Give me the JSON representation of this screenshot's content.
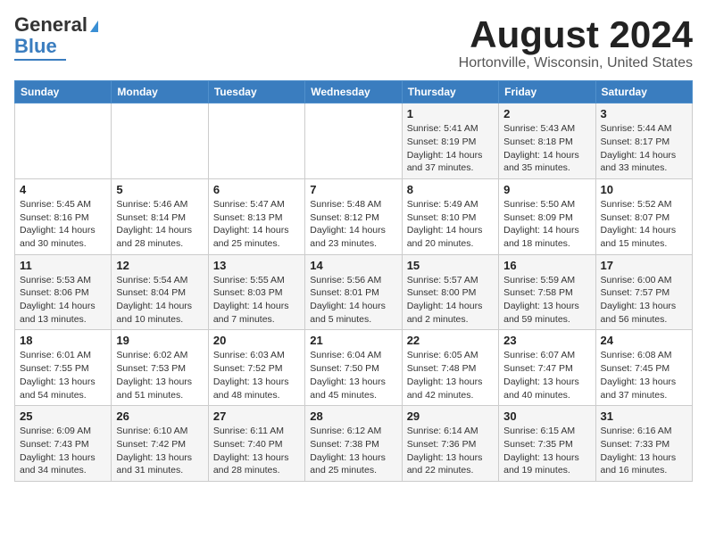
{
  "header": {
    "logo_line1": "General",
    "logo_line2": "Blue",
    "title": "August 2024",
    "location": "Hortonville, Wisconsin, United States"
  },
  "days_of_week": [
    "Sunday",
    "Monday",
    "Tuesday",
    "Wednesday",
    "Thursday",
    "Friday",
    "Saturday"
  ],
  "weeks": [
    [
      {
        "day": "",
        "info": ""
      },
      {
        "day": "",
        "info": ""
      },
      {
        "day": "",
        "info": ""
      },
      {
        "day": "",
        "info": ""
      },
      {
        "day": "1",
        "info": "Sunrise: 5:41 AM\nSunset: 8:19 PM\nDaylight: 14 hours\nand 37 minutes."
      },
      {
        "day": "2",
        "info": "Sunrise: 5:43 AM\nSunset: 8:18 PM\nDaylight: 14 hours\nand 35 minutes."
      },
      {
        "day": "3",
        "info": "Sunrise: 5:44 AM\nSunset: 8:17 PM\nDaylight: 14 hours\nand 33 minutes."
      }
    ],
    [
      {
        "day": "4",
        "info": "Sunrise: 5:45 AM\nSunset: 8:16 PM\nDaylight: 14 hours\nand 30 minutes."
      },
      {
        "day": "5",
        "info": "Sunrise: 5:46 AM\nSunset: 8:14 PM\nDaylight: 14 hours\nand 28 minutes."
      },
      {
        "day": "6",
        "info": "Sunrise: 5:47 AM\nSunset: 8:13 PM\nDaylight: 14 hours\nand 25 minutes."
      },
      {
        "day": "7",
        "info": "Sunrise: 5:48 AM\nSunset: 8:12 PM\nDaylight: 14 hours\nand 23 minutes."
      },
      {
        "day": "8",
        "info": "Sunrise: 5:49 AM\nSunset: 8:10 PM\nDaylight: 14 hours\nand 20 minutes."
      },
      {
        "day": "9",
        "info": "Sunrise: 5:50 AM\nSunset: 8:09 PM\nDaylight: 14 hours\nand 18 minutes."
      },
      {
        "day": "10",
        "info": "Sunrise: 5:52 AM\nSunset: 8:07 PM\nDaylight: 14 hours\nand 15 minutes."
      }
    ],
    [
      {
        "day": "11",
        "info": "Sunrise: 5:53 AM\nSunset: 8:06 PM\nDaylight: 14 hours\nand 13 minutes."
      },
      {
        "day": "12",
        "info": "Sunrise: 5:54 AM\nSunset: 8:04 PM\nDaylight: 14 hours\nand 10 minutes."
      },
      {
        "day": "13",
        "info": "Sunrise: 5:55 AM\nSunset: 8:03 PM\nDaylight: 14 hours\nand 7 minutes."
      },
      {
        "day": "14",
        "info": "Sunrise: 5:56 AM\nSunset: 8:01 PM\nDaylight: 14 hours\nand 5 minutes."
      },
      {
        "day": "15",
        "info": "Sunrise: 5:57 AM\nSunset: 8:00 PM\nDaylight: 14 hours\nand 2 minutes."
      },
      {
        "day": "16",
        "info": "Sunrise: 5:59 AM\nSunset: 7:58 PM\nDaylight: 13 hours\nand 59 minutes."
      },
      {
        "day": "17",
        "info": "Sunrise: 6:00 AM\nSunset: 7:57 PM\nDaylight: 13 hours\nand 56 minutes."
      }
    ],
    [
      {
        "day": "18",
        "info": "Sunrise: 6:01 AM\nSunset: 7:55 PM\nDaylight: 13 hours\nand 54 minutes."
      },
      {
        "day": "19",
        "info": "Sunrise: 6:02 AM\nSunset: 7:53 PM\nDaylight: 13 hours\nand 51 minutes."
      },
      {
        "day": "20",
        "info": "Sunrise: 6:03 AM\nSunset: 7:52 PM\nDaylight: 13 hours\nand 48 minutes."
      },
      {
        "day": "21",
        "info": "Sunrise: 6:04 AM\nSunset: 7:50 PM\nDaylight: 13 hours\nand 45 minutes."
      },
      {
        "day": "22",
        "info": "Sunrise: 6:05 AM\nSunset: 7:48 PM\nDaylight: 13 hours\nand 42 minutes."
      },
      {
        "day": "23",
        "info": "Sunrise: 6:07 AM\nSunset: 7:47 PM\nDaylight: 13 hours\nand 40 minutes."
      },
      {
        "day": "24",
        "info": "Sunrise: 6:08 AM\nSunset: 7:45 PM\nDaylight: 13 hours\nand 37 minutes."
      }
    ],
    [
      {
        "day": "25",
        "info": "Sunrise: 6:09 AM\nSunset: 7:43 PM\nDaylight: 13 hours\nand 34 minutes."
      },
      {
        "day": "26",
        "info": "Sunrise: 6:10 AM\nSunset: 7:42 PM\nDaylight: 13 hours\nand 31 minutes."
      },
      {
        "day": "27",
        "info": "Sunrise: 6:11 AM\nSunset: 7:40 PM\nDaylight: 13 hours\nand 28 minutes."
      },
      {
        "day": "28",
        "info": "Sunrise: 6:12 AM\nSunset: 7:38 PM\nDaylight: 13 hours\nand 25 minutes."
      },
      {
        "day": "29",
        "info": "Sunrise: 6:14 AM\nSunset: 7:36 PM\nDaylight: 13 hours\nand 22 minutes."
      },
      {
        "day": "30",
        "info": "Sunrise: 6:15 AM\nSunset: 7:35 PM\nDaylight: 13 hours\nand 19 minutes."
      },
      {
        "day": "31",
        "info": "Sunrise: 6:16 AM\nSunset: 7:33 PM\nDaylight: 13 hours\nand 16 minutes."
      }
    ]
  ]
}
